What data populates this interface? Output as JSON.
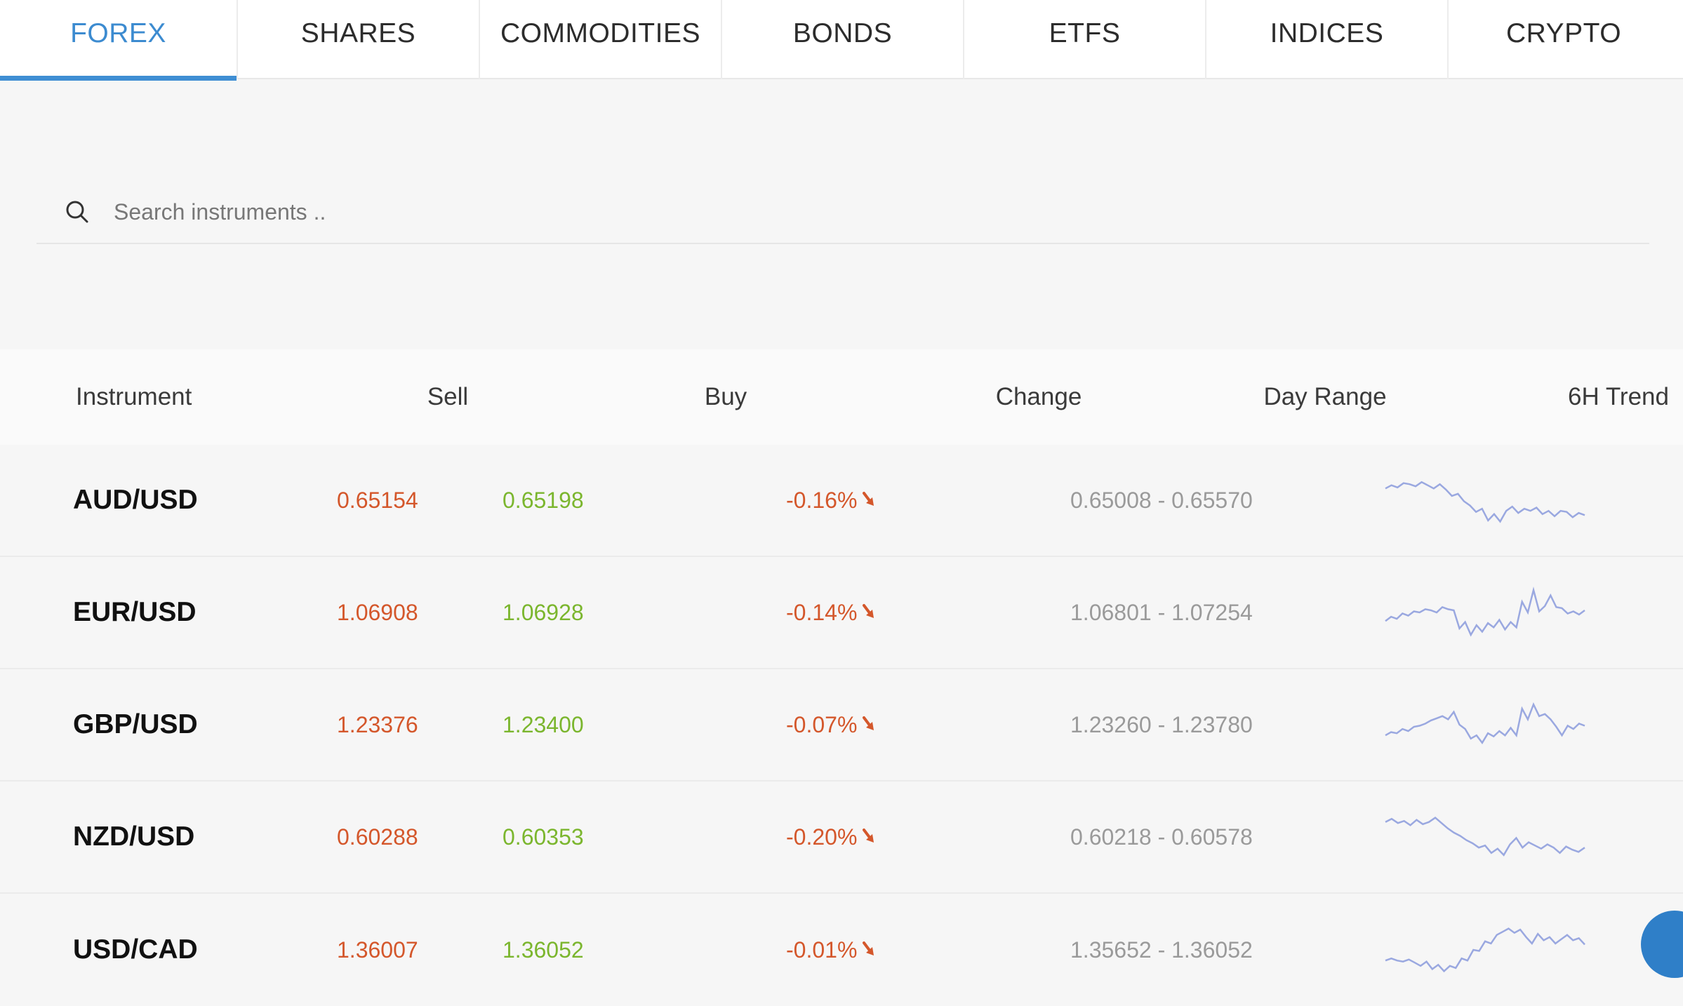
{
  "tabs": [
    {
      "label": "FOREX",
      "active": true
    },
    {
      "label": "SHARES",
      "active": false
    },
    {
      "label": "COMMODITIES",
      "active": false
    },
    {
      "label": "BONDS",
      "active": false
    },
    {
      "label": "ETFS",
      "active": false
    },
    {
      "label": "INDICES",
      "active": false
    },
    {
      "label": "CRYPTO",
      "active": false
    }
  ],
  "search": {
    "placeholder": "Search instruments ..",
    "value": "",
    "icon": "search-icon"
  },
  "table": {
    "headers": {
      "instrument": "Instrument",
      "sell": "Sell",
      "buy": "Buy",
      "change": "Change",
      "day_range": "Day Range",
      "trend": "6H Trend"
    },
    "rows": [
      {
        "instrument": "AUD/USD",
        "sell": "0.65154",
        "buy": "0.65198",
        "change": "-0.16%",
        "direction": "down",
        "day_range": "0.65008 - 0.65570",
        "trend": [
          0.72,
          0.78,
          0.74,
          0.82,
          0.8,
          0.76,
          0.84,
          0.78,
          0.72,
          0.8,
          0.7,
          0.58,
          0.62,
          0.48,
          0.4,
          0.28,
          0.34,
          0.12,
          0.24,
          0.1,
          0.3,
          0.38,
          0.26,
          0.34,
          0.3,
          0.36,
          0.24,
          0.3,
          0.2,
          0.3,
          0.28,
          0.18,
          0.26,
          0.22
        ]
      },
      {
        "instrument": "EUR/USD",
        "sell": "1.06908",
        "buy": "1.06928",
        "change": "-0.14%",
        "direction": "down",
        "day_range": "1.06801 - 1.07254",
        "trend": [
          0.34,
          0.42,
          0.38,
          0.48,
          0.44,
          0.52,
          0.5,
          0.56,
          0.54,
          0.5,
          0.6,
          0.56,
          0.54,
          0.2,
          0.32,
          0.08,
          0.26,
          0.14,
          0.3,
          0.22,
          0.36,
          0.18,
          0.32,
          0.22,
          0.7,
          0.5,
          0.92,
          0.52,
          0.62,
          0.82,
          0.6,
          0.58,
          0.48,
          0.52,
          0.46,
          0.54
        ]
      },
      {
        "instrument": "GBP/USD",
        "sell": "1.23376",
        "buy": "1.23400",
        "change": "-0.07%",
        "direction": "down",
        "day_range": "1.23260 - 1.23780",
        "trend": [
          0.3,
          0.36,
          0.34,
          0.42,
          0.38,
          0.46,
          0.48,
          0.52,
          0.58,
          0.62,
          0.66,
          0.6,
          0.74,
          0.5,
          0.42,
          0.24,
          0.3,
          0.16,
          0.34,
          0.28,
          0.38,
          0.3,
          0.44,
          0.3,
          0.8,
          0.6,
          0.88,
          0.66,
          0.7,
          0.6,
          0.46,
          0.3,
          0.48,
          0.42,
          0.52,
          0.48
        ]
      },
      {
        "instrument": "NZD/USD",
        "sell": "0.60288",
        "buy": "0.60353",
        "change": "-0.20%",
        "direction": "down",
        "day_range": "0.60218 - 0.60578",
        "trend": [
          0.78,
          0.84,
          0.76,
          0.8,
          0.72,
          0.82,
          0.74,
          0.78,
          0.86,
          0.76,
          0.66,
          0.58,
          0.52,
          0.44,
          0.38,
          0.3,
          0.34,
          0.2,
          0.28,
          0.16,
          0.36,
          0.48,
          0.3,
          0.4,
          0.34,
          0.28,
          0.36,
          0.3,
          0.2,
          0.32,
          0.26,
          0.22,
          0.3
        ]
      },
      {
        "instrument": "USD/CAD",
        "sell": "1.36007",
        "buy": "1.36052",
        "change": "-0.01%",
        "direction": "down",
        "day_range": "1.35652 - 1.36052",
        "trend": [
          0.3,
          0.34,
          0.3,
          0.28,
          0.32,
          0.26,
          0.2,
          0.28,
          0.14,
          0.22,
          0.1,
          0.2,
          0.16,
          0.34,
          0.3,
          0.5,
          0.48,
          0.66,
          0.62,
          0.78,
          0.84,
          0.9,
          0.82,
          0.88,
          0.74,
          0.62,
          0.8,
          0.68,
          0.74,
          0.62,
          0.7,
          0.78,
          0.68,
          0.72,
          0.6
        ]
      }
    ]
  },
  "colors": {
    "accent": "#3c8bd0",
    "sell": "#d4572b",
    "buy": "#7bb62e",
    "trend_line": "#9aa8e0"
  }
}
